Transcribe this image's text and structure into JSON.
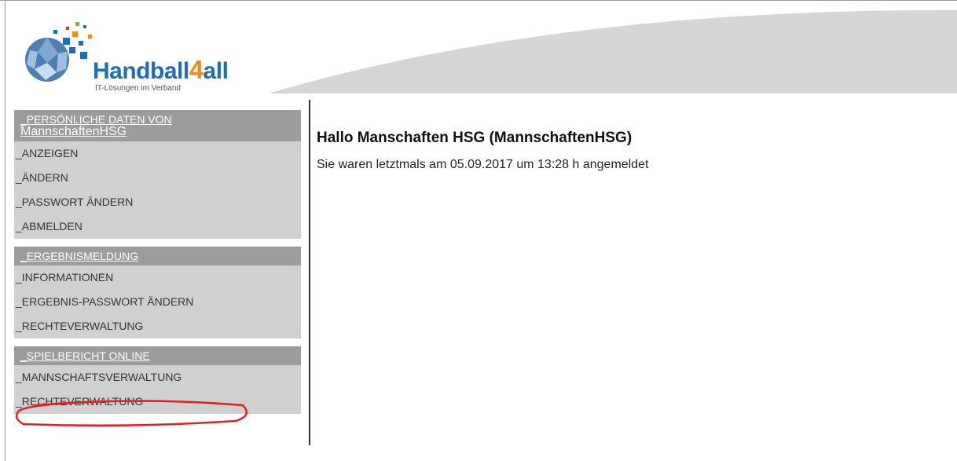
{
  "brand": {
    "name_part1": "Handball",
    "name_part2": "4",
    "name_part3": "all",
    "tagline": "IT-Lösungen im Verband",
    "colors": {
      "blue": "#1f6eb3",
      "orange": "#f28a14",
      "menu_header": "#9c9c9c",
      "menu_bg": "#d0d0d0",
      "annotation": "#e02020"
    }
  },
  "sidebar": {
    "groups": [
      {
        "title": "_PERSÖNLICHE DATEN VON",
        "username": "MannschaftenHSG",
        "items": [
          "_ANZEIGEN",
          "_ÄNDERN",
          "_PASSWORT ÄNDERN",
          "_ABMELDEN"
        ]
      },
      {
        "title": "_ERGEBNISMELDUNG",
        "items": [
          "_INFORMATIONEN",
          "_ERGEBNIS-PASSWORT ÄNDERN",
          "_RECHTEVERWALTUNG"
        ]
      },
      {
        "title": "_SPIELBERICHT ONLINE",
        "items": [
          "_MANNSCHAFTSVERWALTUNG",
          "_RECHTEVERWALTUNG"
        ]
      }
    ]
  },
  "main": {
    "greeting": "Hallo Manschaften HSG (MannschaftenHSG)",
    "last_login": "Sie waren letztmals am 05.09.2017 um 13:28 h angemeldet"
  }
}
